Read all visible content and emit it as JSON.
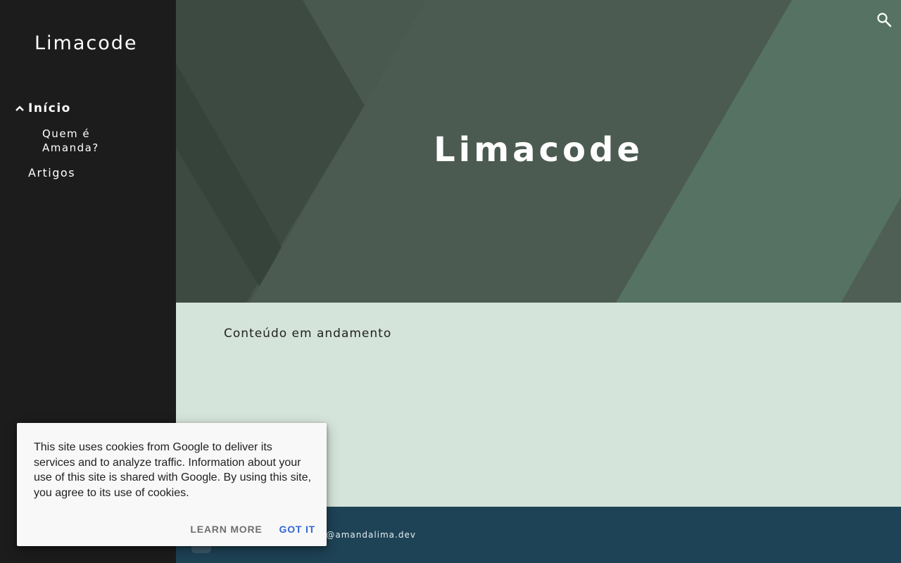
{
  "sidebar": {
    "brand": "Limacode",
    "nav": {
      "inicio": "Início",
      "quem": "Quem é Amanda?",
      "artigos": "Artigos"
    }
  },
  "hero": {
    "title": "Limacode"
  },
  "content": {
    "text": "Conteúdo em andamento"
  },
  "footer": {
    "email_partial": "a@amandalima.dev"
  },
  "cookie_banner": {
    "message": "This site uses cookies from Google to deliver its services and to analyze traffic. Information about your use of this site is shared with Google. By using this site, you agree to its use of cookies.",
    "learn_more": "Learn more",
    "got_it": "Got it"
  },
  "icons": {
    "search": "search-icon",
    "chevron": "chevron-up-icon"
  },
  "colors": {
    "sidebar_bg": "#1c1c1c",
    "hero_bg": "#46554c",
    "content_bg": "#d5e4da",
    "footer_bg": "#1e4356",
    "accent": "#3367d6"
  }
}
